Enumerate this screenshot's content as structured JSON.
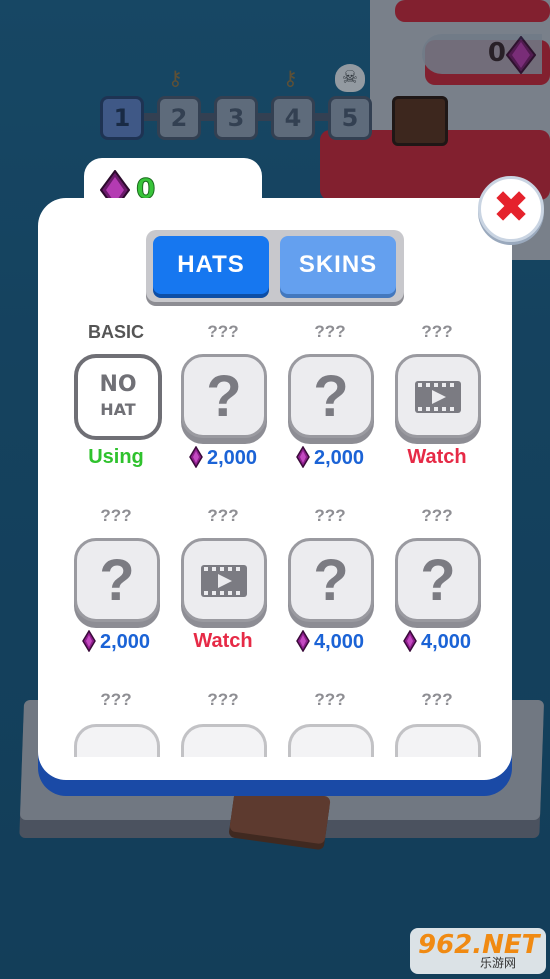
{
  "top_bar": {
    "gem_count": "0",
    "levels": [
      "1",
      "2",
      "3",
      "4",
      "5"
    ],
    "active_level": "1"
  },
  "panel": {
    "gem_balance": "0",
    "close_symbol": "✖",
    "tabs": [
      {
        "label": "HATS",
        "selected": true
      },
      {
        "label": "SKINS",
        "selected": false
      }
    ],
    "items": [
      {
        "name": "BASIC",
        "box": "NO HAT",
        "label": "Using",
        "kind": "using"
      },
      {
        "name": "???",
        "box": "?",
        "label": "2,000",
        "kind": "price"
      },
      {
        "name": "???",
        "box": "?",
        "label": "2,000",
        "kind": "price"
      },
      {
        "name": "???",
        "box": "video",
        "label": "Watch",
        "kind": "watch"
      },
      {
        "name": "???",
        "box": "?",
        "label": "2,000",
        "kind": "price"
      },
      {
        "name": "???",
        "box": "video",
        "label": "Watch",
        "kind": "watch"
      },
      {
        "name": "???",
        "box": "?",
        "label": "4,000",
        "kind": "price"
      },
      {
        "name": "???",
        "box": "?",
        "label": "4,000",
        "kind": "price"
      },
      {
        "name": "???",
        "box": "?",
        "label": "",
        "kind": "partial"
      },
      {
        "name": "???",
        "box": "?",
        "label": "",
        "kind": "partial"
      },
      {
        "name": "???",
        "box": "?",
        "label": "",
        "kind": "partial"
      },
      {
        "name": "???",
        "box": "?",
        "label": "",
        "kind": "partial"
      }
    ],
    "nohat_line1": "NO",
    "nohat_line2": "HAT",
    "question_mark": "?"
  },
  "watermark": {
    "big": "962.NET",
    "small": "乐游网"
  },
  "colors": {
    "tab_selected": "#1677f0",
    "tab_unselected": "#64a0ef",
    "using": "#2fc22d",
    "watch": "#e62a46",
    "price": "#1b63d6",
    "gem": "#8e1e8c",
    "close": "#e5222c"
  }
}
